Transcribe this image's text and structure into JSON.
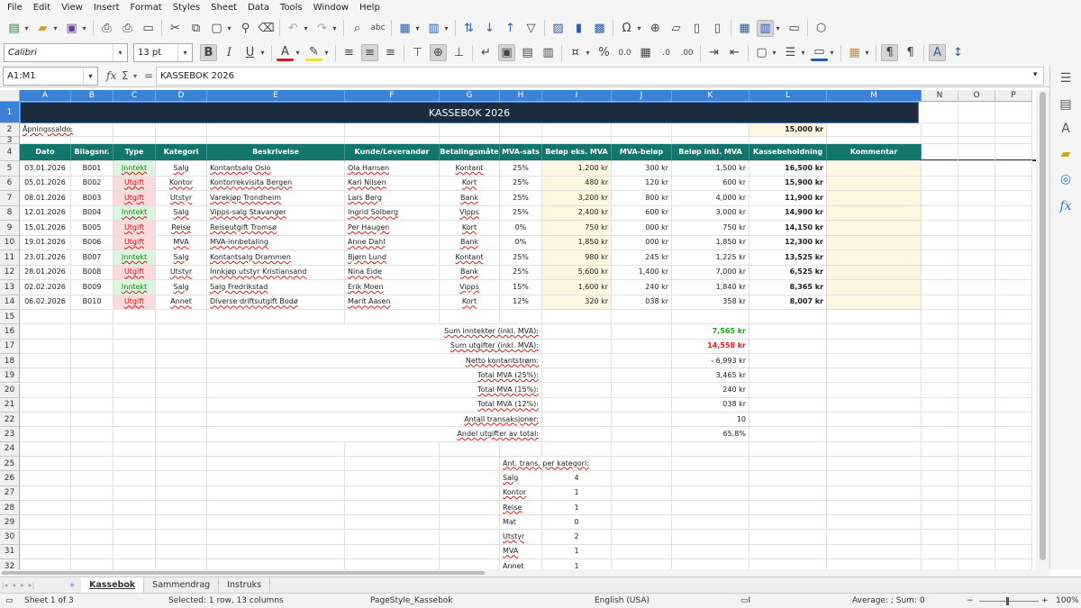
{
  "menubar": [
    "File",
    "Edit",
    "View",
    "Insert",
    "Format",
    "Styles",
    "Sheet",
    "Data",
    "Tools",
    "Window",
    "Help"
  ],
  "toolbar": {
    "font_name": "Calibri",
    "font_size": "13 pt"
  },
  "formula_bar": {
    "name_box": "A1:M1",
    "content": "KASSEBOK 2026"
  },
  "sheet": {
    "columns": [
      "A",
      "B",
      "C",
      "D",
      "E",
      "F",
      "G",
      "H",
      "I",
      "J",
      "K",
      "L",
      "M",
      "N",
      "O",
      "P"
    ],
    "title": "KASSEBOK 2026",
    "opening_label": "Åpningssaldo:",
    "opening_value": "15,000 kr",
    "headers": [
      "Dato",
      "Bilagsnr.",
      "Type",
      "Kategori",
      "Beskrivelse",
      "Kunde/Leverandør",
      "Betalingsmåte",
      "MVA-sats",
      "Beløp eks. MVA",
      "MVA-beløp",
      "Beløp inkl. MVA",
      "Kassebeholdning",
      "Kommentar"
    ],
    "rows": [
      [
        "03.01.2026",
        "B001",
        "Inntekt",
        "Salg",
        "Kontantsalg Oslo",
        "Ola Hansen",
        "Kontant",
        "25%",
        "1,200 kr",
        "300 kr",
        "1,500 kr",
        "16,500 kr",
        ""
      ],
      [
        "05.01.2026",
        "B002",
        "Utgift",
        "Kontor",
        "Kontorrekvisita Bergen",
        "Kari Nilsen",
        "Kort",
        "25%",
        "480 kr",
        "120 kr",
        "600 kr",
        "15,900 kr",
        ""
      ],
      [
        "08.01.2026",
        "B003",
        "Utgift",
        "Utstyr",
        "Varekjøp Trondheim",
        "Lars Berg",
        "Bank",
        "25%",
        "3,200 kr",
        "800 kr",
        "4,000 kr",
        "11,900 kr",
        ""
      ],
      [
        "12.01.2026",
        "B004",
        "Inntekt",
        "Salg",
        "Vipps-salg Stavanger",
        "Ingrid Solberg",
        "Vipps",
        "25%",
        "2,400 kr",
        "600 kr",
        "3,000 kr",
        "14,900 kr",
        ""
      ],
      [
        "15.01.2026",
        "B005",
        "Utgift",
        "Reise",
        "Reiseutgift Tromsø",
        "Per Haugen",
        "Kort",
        "0%",
        "750 kr",
        "000 kr",
        "750 kr",
        "14,150 kr",
        ""
      ],
      [
        "19.01.2026",
        "B006",
        "Utgift",
        "MVA",
        "MVA-innbetaling",
        "Anne Dahl",
        "Bank",
        "0%",
        "1,850 kr",
        "000 kr",
        "1,850 kr",
        "12,300 kr",
        ""
      ],
      [
        "23.01.2026",
        "B007",
        "Inntekt",
        "Salg",
        "Kontantsalg Drammen",
        "Bjørn Lund",
        "Kontant",
        "25%",
        "980 kr",
        "245 kr",
        "1,225 kr",
        "13,525 kr",
        ""
      ],
      [
        "28.01.2026",
        "B008",
        "Utgift",
        "Utstyr",
        "Innkjøp utstyr Kristiansand",
        "Nina Eide",
        "Bank",
        "25%",
        "5,600 kr",
        "1,400 kr",
        "7,000 kr",
        "6,525 kr",
        ""
      ],
      [
        "02.02.2026",
        "B009",
        "Inntekt",
        "Salg",
        "Salg Fredrikstad",
        "Erik Moen",
        "Vipps",
        "15%",
        "1,600 kr",
        "240 kr",
        "1,840 kr",
        "8,365 kr",
        ""
      ],
      [
        "06.02.2026",
        "B010",
        "Utgift",
        "Annet",
        "Diverse driftsutgift Bodø",
        "Marit Aasen",
        "Kort",
        "12%",
        "320 kr",
        "038 kr",
        "358 kr",
        "8,007 kr",
        ""
      ]
    ],
    "summary": [
      {
        "label": "Sum inntekter (inkl. MVA):",
        "value": "7,565 kr",
        "style": "green"
      },
      {
        "label": "Sum utgifter (inkl. MVA):",
        "value": "14,558 kr",
        "style": "red"
      },
      {
        "label": "Netto kontantstrøm:",
        "value": "- 6,993 kr",
        "style": ""
      },
      {
        "label": "Total MVA (25%):",
        "value": "3,465 kr",
        "style": ""
      },
      {
        "label": "Total MVA (15%):",
        "value": "240 kr",
        "style": ""
      },
      {
        "label": "Total MVA (12%):",
        "value": "038 kr",
        "style": ""
      },
      {
        "label": "Antall transaksjoner:",
        "value": "10",
        "style": ""
      },
      {
        "label": "Andel utgifter av total:",
        "value": "65.8%",
        "style": ""
      }
    ],
    "category_title": "Ant. trans. per kategori:",
    "categories": [
      {
        "name": "Salg",
        "count": "4"
      },
      {
        "name": "Kontor",
        "count": "1"
      },
      {
        "name": "Reise",
        "count": "1"
      },
      {
        "name": "Mat",
        "count": "0"
      },
      {
        "name": "Utstyr",
        "count": "2"
      },
      {
        "name": "MVA",
        "count": "1"
      },
      {
        "name": "Annet",
        "count": "1"
      }
    ]
  },
  "sheet_tabs": [
    "Kassebok",
    "Sammendrag",
    "Instruks"
  ],
  "status": {
    "sheet_info": "Sheet 1 of 3",
    "selection": "Selected: 1 row, 13 columns",
    "page_style": "PageStyle_Kassebok",
    "language": "English (USA)",
    "summary": "Average: ; Sum: 0",
    "zoom": "100%"
  }
}
